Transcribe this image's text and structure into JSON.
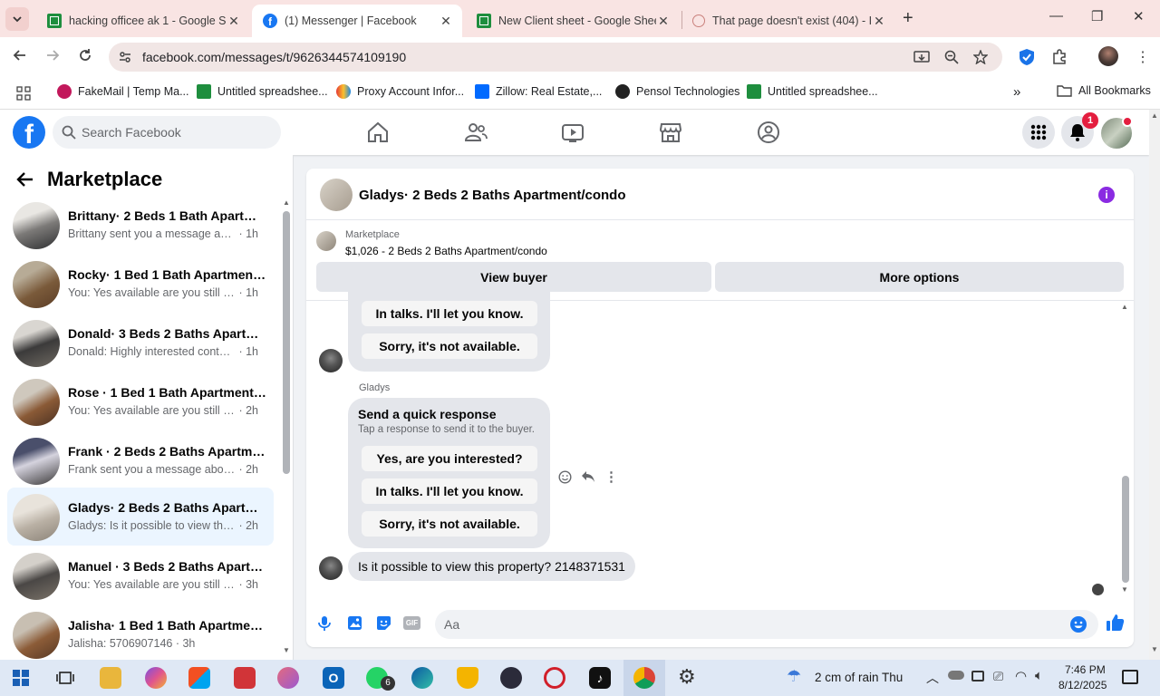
{
  "browser": {
    "tabs": [
      {
        "title": "hacking officee ak 1 - Google Sh",
        "icon": "sheets-icon",
        "active": false
      },
      {
        "title": "(1) Messenger | Facebook",
        "icon": "facebook-icon",
        "active": true
      },
      {
        "title": "New Client sheet - Google Shee",
        "icon": "sheets-icon",
        "active": false
      },
      {
        "title": "That page doesn't exist (404) - I",
        "icon": "error-page-icon",
        "active": false
      }
    ],
    "url": "facebook.com/messages/t/9626344574109190",
    "bookmarks": [
      {
        "label": "FakeMail | Temp Ma...",
        "icon": "fakemail-icon"
      },
      {
        "label": "Untitled spreadshee...",
        "icon": "sheets-icon"
      },
      {
        "label": "Proxy Account Infor...",
        "icon": "proxy-icon"
      },
      {
        "label": "Zillow: Real Estate,...",
        "icon": "zillow-icon"
      },
      {
        "label": "Pensol Technologies",
        "icon": "pensol-icon"
      },
      {
        "label": "Untitled spreadshee...",
        "icon": "sheets-icon"
      }
    ],
    "all_bookmarks": "All Bookmarks",
    "colors": {
      "tabstrip": "#f9e4e3",
      "omnibox": "#f1e6e5"
    }
  },
  "facebook": {
    "search_placeholder": "Search Facebook",
    "notification_count": "1",
    "brand_color": "#1877f2"
  },
  "sidebar": {
    "title": "Marketplace",
    "conversations": [
      {
        "name": "Brittany· 2 Beds 1 Bath Apartme...",
        "snippet": "Brittany sent you a message about ...",
        "time": "1h",
        "selected": false
      },
      {
        "name": "Rocky· 1 Bed 1 Bath Apartment/...",
        "snippet": "You: Yes available are you still inter...",
        "time": "1h",
        "selected": false
      },
      {
        "name": "Donald· 3 Beds 2 Baths Apartm...",
        "snippet": "Donald: Highly interested contact ...",
        "time": "1h",
        "selected": false
      },
      {
        "name": "Rose · 1 Bed 1 Bath Apartment/c...",
        "snippet": "You: Yes available are you still inter...",
        "time": "2h",
        "selected": false
      },
      {
        "name": "Frank · 2 Beds 2 Baths Apartme...",
        "snippet": "Frank sent you a message about y...",
        "time": "2h",
        "selected": false
      },
      {
        "name": "Gladys· 2 Beds 2 Baths Apartme...",
        "snippet": "Gladys: Is it possible to view this pr...",
        "time": "2h",
        "selected": true
      },
      {
        "name": "Manuel · 3 Beds 2 Baths Apartm...",
        "snippet": "You: Yes available are you still inter...",
        "time": "3h",
        "selected": false
      },
      {
        "name": "Jalisha· 1 Bed 1 Bath Apartment/...",
        "snippet": "Jalisha: 5706907146",
        "time": "3h",
        "selected": false
      }
    ]
  },
  "conversation": {
    "title": "Gladys· 2 Beds 2 Baths Apartment/condo",
    "marketplace_label": "Marketplace",
    "listing": "$1,026 - 2 Beds 2 Baths Apartment/condo",
    "view_buyer": "View buyer",
    "more_options": "More options",
    "prev_quick_replies": [
      "In talks. I'll let you know.",
      "Sorry, it's not available."
    ],
    "sender_name": "Gladys",
    "quick_response_title": "Send a quick response",
    "quick_response_subtitle": "Tap a response to send it to the buyer.",
    "quick_replies": [
      "Yes, are you interested?",
      "In talks. I'll let you know.",
      "Sorry, it's not available."
    ],
    "last_message": "Is it possible to view this property? 2148371531",
    "composer_placeholder": "Aa"
  },
  "taskbar": {
    "weather": "2 cm of rain Thu",
    "time": "7:46 PM",
    "date": "8/12/2025",
    "whatsapp_badge": "6"
  }
}
